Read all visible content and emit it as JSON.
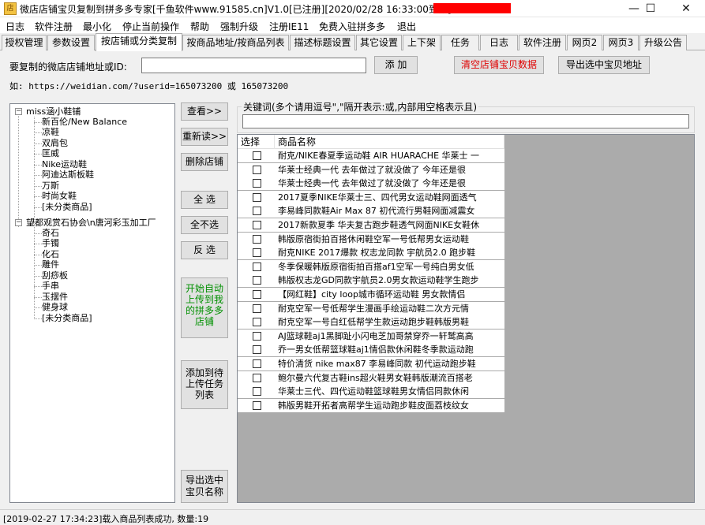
{
  "window": {
    "title": "微店店铺宝贝复制到拼多多专家[千鱼软件www.91585.cn]V1.0[已注册][2020/02/28 16:33:00到期]-",
    "minimize": "—",
    "maximize": "☐",
    "close": "✕"
  },
  "menu": [
    "日志",
    "软件注册",
    "最小化",
    "停止当前操作",
    "帮助",
    "强制升级",
    "注册IE11",
    "免费入驻拼多多",
    "退出"
  ],
  "tabs": [
    "授权管理",
    "参数设置",
    "按店铺或分类复制",
    "按商品地址/按商品列表",
    "描述标题设置",
    "其它设置",
    "上下架",
    "任务",
    "日志",
    "软件注册",
    "网页2",
    "网页3",
    "升级公告"
  ],
  "url_row": {
    "label": "要复制的微店店铺地址或ID:",
    "value": "",
    "add_button": "添  加",
    "clear_button": "清空店铺宝贝数据",
    "export_button": "导出选中宝贝地址",
    "example": "如: https://weidian.com/?userid=165073200 或 165073200"
  },
  "tree": [
    {
      "label": "miss涵小鞋铺",
      "children": [
        "新百伦/New Balance",
        "凉鞋",
        "双肩包",
        "匡威",
        "Nike运动鞋",
        "阿迪达斯板鞋",
        "万斯",
        "时尚女鞋",
        "[未分类商品]"
      ]
    },
    {
      "label": "望都观赏石协会\\n唐河彩玉加工厂",
      "children": [
        "奇石",
        "手镯",
        "化石",
        "雕件",
        "刮痧板",
        "手串",
        "玉摆件",
        "健身球",
        "[未分类商品]"
      ]
    }
  ],
  "side_buttons": {
    "view": "查看>>",
    "reload": "重新读>>",
    "delete_shop": "删除店铺",
    "select_all": "全  选",
    "select_none": "全不选",
    "invert": "反  选",
    "start_upload": [
      "开始自动",
      "上传到我",
      "的拼多多",
      "店铺"
    ],
    "add_task": [
      "添加到待",
      "上传任务",
      "列表"
    ],
    "export_names": [
      "导出选中",
      "宝贝名称"
    ]
  },
  "keyword": {
    "label": "关键词(多个请用逗号\",\"隔开表示:或,内部用空格表示且)",
    "value": ""
  },
  "list": {
    "headers": [
      "选择",
      "商品名称"
    ],
    "rows": [
      "耐克/NIKE春夏季运动鞋  AIR HUARACHE 华莱士 一",
      "华莱士经典一代  去年做过了就没做了 今年还是很",
      "华莱士经典一代  去年做过了就没做了 今年还是很",
      "2017夏季NIKE华莱士三、四代男女运动鞋网面透气",
      "李易峰同款鞋Air Max 87 初代流行男鞋网面减震女",
      "2017新款夏季  华夫复古跑步鞋透气网面NIKE女鞋休",
      "韩版原宿街拍百搭休闲鞋空军一号低帮男女运动鞋",
      "耐克NIKE 2017爆款 权志龙同款 宇航员2.0 跑步鞋",
      "冬季保暖韩版原宿街拍百搭af1空军一号纯白男女低",
      "韩版权志龙GD同款宇航员2.0男女款运动鞋学生跑步",
      "【网红鞋】city loop城市循环运动鞋 男女款情侣",
      "耐克空军一号低帮学生漫画手绘运动鞋二次方元情",
      "耐克空军一号白红低帮学生款运动跑步鞋韩版男鞋",
      "AJ篮球鞋aj1黑脚趾小闪电芝加哥禁穿乔一轩鹫高高",
      "乔一男女低帮篮球鞋aj1情侣款休闲鞋冬季款运动跑",
      "特价清货 nike max87 李易峰同款 初代运动跑步鞋",
      "鲍尔曼六代复古鞋ins超火鞋男女鞋韩版潮流百搭老",
      "华莱士三代、四代运动鞋篮球鞋男女情侣同款休闲",
      "韩版男鞋开拓者高帮学生运动跑步鞋皮面荔枝纹女"
    ]
  },
  "status": "[2019-02-27 17:34:23]载入商品列表成功, 数量:19"
}
